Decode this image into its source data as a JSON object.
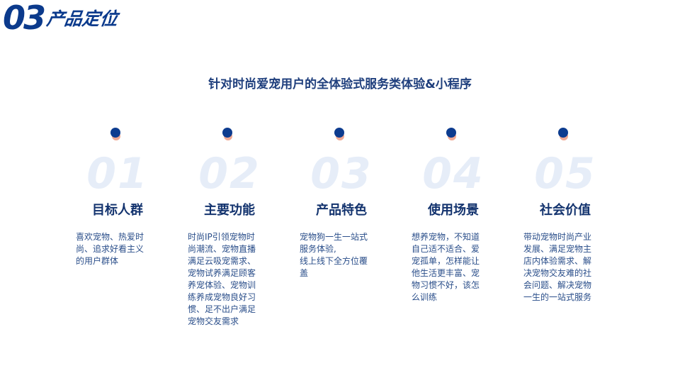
{
  "header": {
    "number": "03",
    "title": "产品定位"
  },
  "subtitle": "针对时尚爱宠用户的全体验式服务类体验&小程序",
  "columns": [
    {
      "num": "01",
      "title": "目标人群",
      "lines": [
        "喜欢宠物、热爱时",
        "尚、追求好看主义",
        "的用户群体"
      ]
    },
    {
      "num": "02",
      "title": "主要功能",
      "lines": [
        "时尚IP引领宠物时",
        "尚潮流、宠物直播",
        "满足云吸宠需求、",
        "宠物试养满足顾客",
        "养宠体验、宠物训",
        "练养成宠物良好习",
        "惯、足不出户满足",
        "宠物交友需求"
      ]
    },
    {
      "num": "03",
      "title": "产品特色",
      "lines": [
        "宠物狗一生一站式",
        "服务体验,",
        "线上线下全方位覆",
        "盖"
      ]
    },
    {
      "num": "04",
      "title": "使用场景",
      "lines": [
        "想养宠物，不知道",
        "自己适不适合、爱",
        "宠孤单，怎样能让",
        "他生活更丰富、宠",
        "物习惯不好，该怎",
        "么训练"
      ]
    },
    {
      "num": "05",
      "title": "社会价值",
      "lines": [
        "带动宠物时尚产业",
        "发展、满足宠物主",
        "店内体验需求、解",
        "决宠物交友难的社",
        "会问题、解决宠物",
        "一生的一站式服务"
      ]
    }
  ],
  "colors": {
    "primary": "#0b3a8c",
    "dot_accent": "#f0a994",
    "watermark_number": "#e6edf8",
    "body_text": "#2a4e8a"
  }
}
